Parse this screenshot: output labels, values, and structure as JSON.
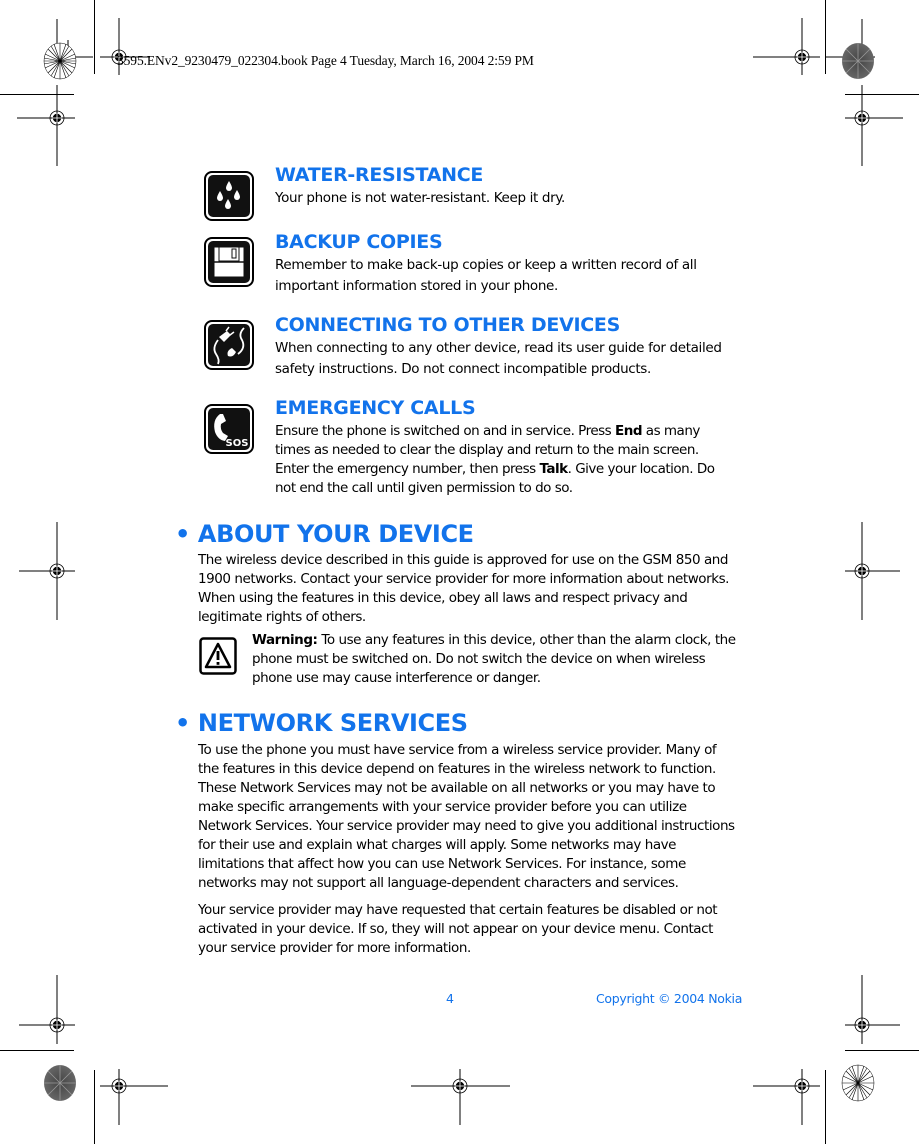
{
  "print_header": "3595.ENv2_9230479_022304.book  Page 4  Tuesday, March 16, 2004  2:59 PM",
  "accent_color": "#1273eb",
  "safety_items": [
    {
      "icon": "water-drops-icon",
      "title": "WATER-RESISTANCE",
      "text": "Your phone is not water-resistant. Keep it dry."
    },
    {
      "icon": "floppy-disk-icon",
      "title": "BACKUP COPIES",
      "text": "Remember to make back-up copies or keep a written record of all important information stored in your phone."
    },
    {
      "icon": "plug-cable-icon",
      "title": "CONNECTING TO OTHER DEVICES",
      "text": "When connecting to any other device, read its user guide for detailed safety instructions. Do not connect incompatible products."
    },
    {
      "icon": "sos-phone-icon",
      "title": "EMERGENCY CALLS",
      "text_parts": {
        "a": "Ensure the phone is switched on and in service. Press ",
        "b_end": "End",
        "c": " as many times as needed to clear the display and return to the main screen. Enter the emergency number, then press ",
        "d_talk": "Talk",
        "e": ". Give your location. Do not end the call until given permission to do so."
      }
    }
  ],
  "about": {
    "heading": "• ABOUT YOUR DEVICE",
    "paragraph": "The wireless device described in this guide is approved for use on the GSM 850 and 1900 networks. Contact your service provider for more information about networks. When using the features in this device, obey all laws and respect privacy and legitimate rights of others.",
    "warning_label": "Warning:",
    "warning_text": " To use any features in this device, other than the alarm clock, the phone must be switched on. Do not switch the device on when wireless phone use may cause interference or danger."
  },
  "network": {
    "heading": "• NETWORK SERVICES",
    "paragraph1": "To use the phone you must have service from a wireless service provider. Many of the features in this device depend on features in the wireless network to function. These Network Services may not be available on all networks or you may have to make specific arrangements with your service provider before you can utilize Network Services. Your service provider may need to give you additional instructions for their use and explain what charges will apply. Some networks may have limitations that affect how you can use Network Services. For instance, some networks may not support all language-dependent characters and services.",
    "paragraph2": "Your service provider may have requested that certain features be disabled or not activated in your device. If so, they will not appear on your device menu. Contact your service provider for more information."
  },
  "footer": {
    "page_number": "4",
    "copyright": "Copyright © 2004 Nokia"
  }
}
